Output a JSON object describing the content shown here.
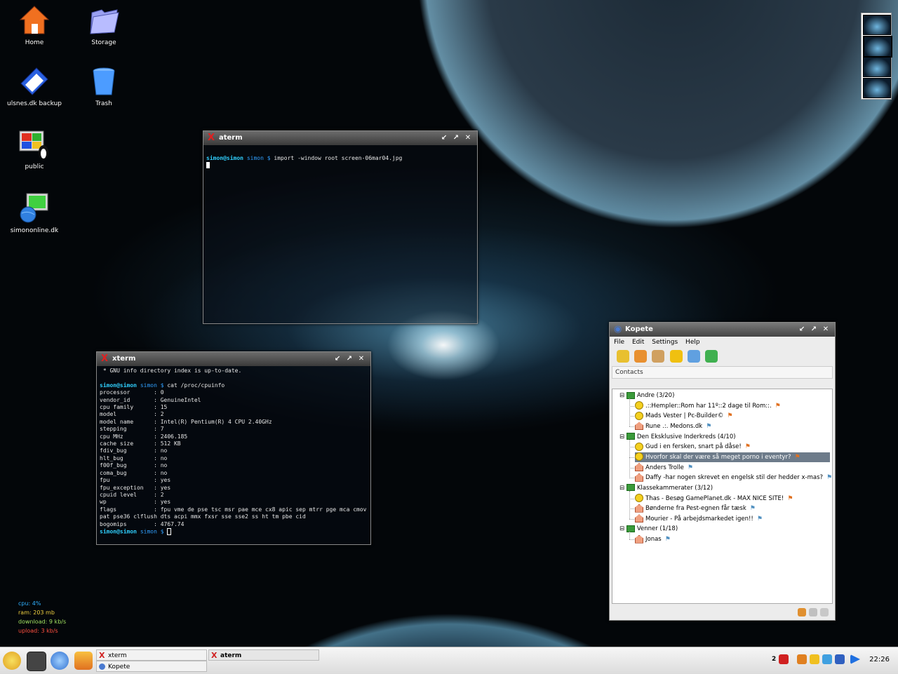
{
  "desktop_icons": [
    {
      "name": "home-icon",
      "label": "Home"
    },
    {
      "name": "storage-icon",
      "label": "Storage"
    },
    {
      "name": "backup-folder-icon",
      "label": "ulsnes.dk backup"
    },
    {
      "name": "trash-icon",
      "label": "Trash"
    },
    {
      "name": "public-share-icon",
      "label": "public"
    },
    {
      "name": "network-icon",
      "label": "simononline.dk"
    }
  ],
  "aterm": {
    "title": "aterm",
    "user": "simon@simon",
    "dir": "simon $",
    "command": " import -window root screen-06mar04.jpg"
  },
  "xterm": {
    "title": "xterm",
    "first_line": " * GNU info directory index is up-to-date.",
    "user": "simon@simon",
    "dir": "simon $",
    "command": " cat /proc/cpuinfo",
    "cpuinfo": [
      "processor       : 0",
      "vendor_id       : GenuineIntel",
      "cpu family      : 15",
      "model           : 2",
      "model name      : Intel(R) Pentium(R) 4 CPU 2.40GHz",
      "stepping        : 7",
      "cpu MHz         : 2406.185",
      "cache size      : 512 KB",
      "fdiv_bug        : no",
      "hlt_bug         : no",
      "f00f_bug        : no",
      "coma_bug        : no",
      "fpu             : yes",
      "fpu_exception   : yes",
      "cpuid level     : 2",
      "wp              : yes",
      "flags           : fpu vme de pse tsc msr pae mce cx8 apic sep mtrr pge mca cmov",
      "pat pse36 clflush dts acpi mmx fxsr sse sse2 ss ht tm pbe cid",
      "bogomips        : 4767.74"
    ],
    "prompt_end": " "
  },
  "kopete": {
    "title": "Kopete",
    "menu": [
      "File",
      "Edit",
      "Settings",
      "Help"
    ],
    "contacts_header": "Contacts",
    "groups": [
      {
        "label": "Andre (3/20)",
        "contacts": [
          {
            "label": ".::Hempler::Rom har 11º::2 dage til Rom::.",
            "status": "online"
          },
          {
            "label": "Mads Vester | Pc-Builder©",
            "status": "online"
          },
          {
            "label": "Rune .:. Medons.dk",
            "status": "offline"
          }
        ]
      },
      {
        "label": "Den Eksklusive Inderkreds (4/10)",
        "contacts": [
          {
            "label": "Gud i en fersken, snart på dåse!",
            "status": "online"
          },
          {
            "label": "Hvorfor skal der være så meget porno i eventyr?",
            "status": "online",
            "selected": true
          },
          {
            "label": "Anders Trolle",
            "status": "offline"
          },
          {
            "label": "Daffy -har nogen skrevet en engelsk stil der hedder x-mas?",
            "status": "offline"
          }
        ]
      },
      {
        "label": "Klassekammerater (3/12)",
        "contacts": [
          {
            "label": "Thas - Besøg GamePlanet.dk - MAX NICE SITE!",
            "status": "online"
          },
          {
            "label": "Bønderne fra Pest-egnen får tæsk",
            "status": "offline"
          },
          {
            "label": "Mourier - På arbejdsmarkedet igen!!",
            "status": "offline"
          }
        ]
      },
      {
        "label": "Venner (1/18)",
        "contacts": [
          {
            "label": "Jonas",
            "status": "offline"
          }
        ]
      }
    ]
  },
  "sysmon": {
    "cpu": "cpu: 4%",
    "ram": "ram: 203 mb",
    "download": "download: 9 kb/s",
    "upload": "upload: 3 kb/s"
  },
  "taskbar": {
    "tasks": [
      "xterm",
      "Kopete",
      "aterm"
    ],
    "desktop_number": "2",
    "clock": "22:26"
  },
  "colors": {
    "cpu": "#30b0ff",
    "ram": "#f0d040",
    "download": "#a0e060",
    "upload": "#ff5040",
    "selection": "#6d7b8a"
  }
}
